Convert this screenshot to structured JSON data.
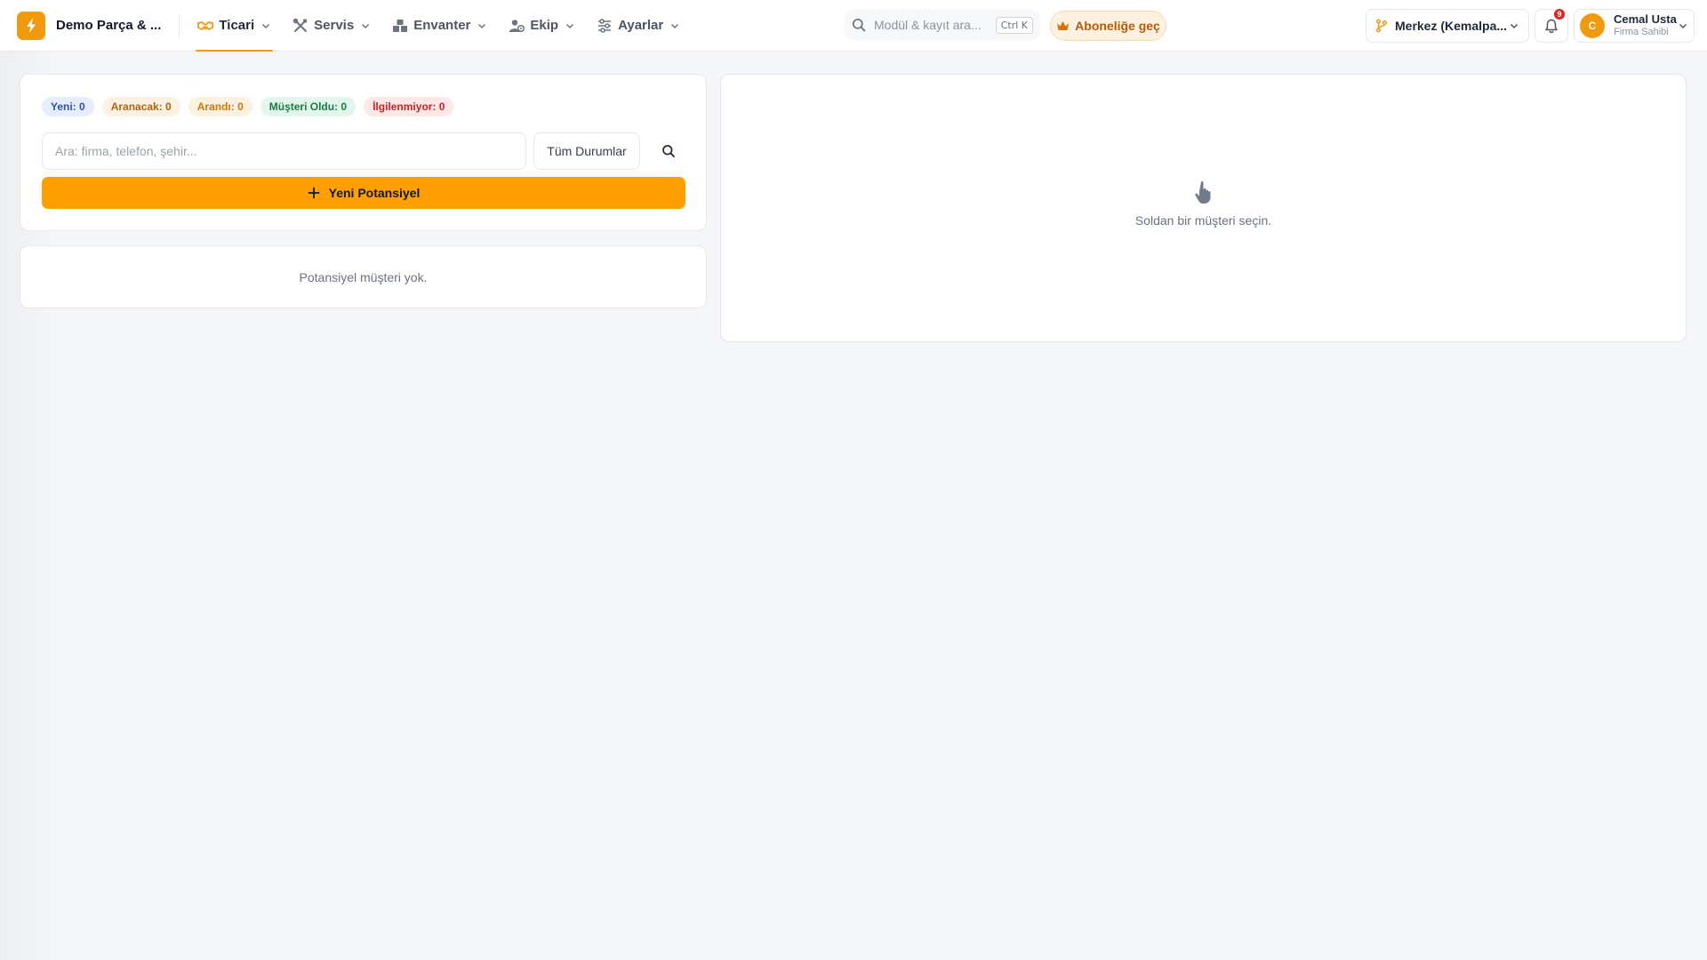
{
  "header": {
    "brand_name": "Demo Parça & ...",
    "nav": [
      {
        "label": "Ticari",
        "icon": "handshake-icon",
        "active": true
      },
      {
        "label": "Servis",
        "icon": "tools-icon",
        "active": false
      },
      {
        "label": "Envanter",
        "icon": "warehouse-icon",
        "active": false
      },
      {
        "label": "Ekip",
        "icon": "team-icon",
        "active": false
      },
      {
        "label": "Ayarlar",
        "icon": "sliders-icon",
        "active": false
      }
    ],
    "search_placeholder": "Modül & kayıt ara...",
    "search_shortcut": "Ctrl K",
    "subscribe_label": "Aboneliğe geç",
    "branch_label": "Merkez (Kemalpa...",
    "notification_count": "9",
    "user": {
      "initial": "C",
      "name": "Cemal Usta",
      "role": "Firma Sahibi"
    }
  },
  "filters": {
    "stats": [
      {
        "label": "Yeni: 0",
        "tone": "blue"
      },
      {
        "label": "Aranacak: 0",
        "tone": "amber"
      },
      {
        "label": "Arandı: 0",
        "tone": "orange"
      },
      {
        "label": "Müşteri Oldu: 0",
        "tone": "green"
      },
      {
        "label": "İlgilenmiyor: 0",
        "tone": "red"
      }
    ],
    "search_placeholder": "Ara: firma, telefon, şehir...",
    "status_select": "Tüm Durumlar",
    "new_button": "Yeni Potansiyel"
  },
  "list": {
    "empty_message": "Potansiyel müşteri yok."
  },
  "detail": {
    "empty_message": "Soldan bir müşteri seçin."
  },
  "colors": {
    "accent": "#ffa000",
    "brand": "#f29a0f"
  }
}
